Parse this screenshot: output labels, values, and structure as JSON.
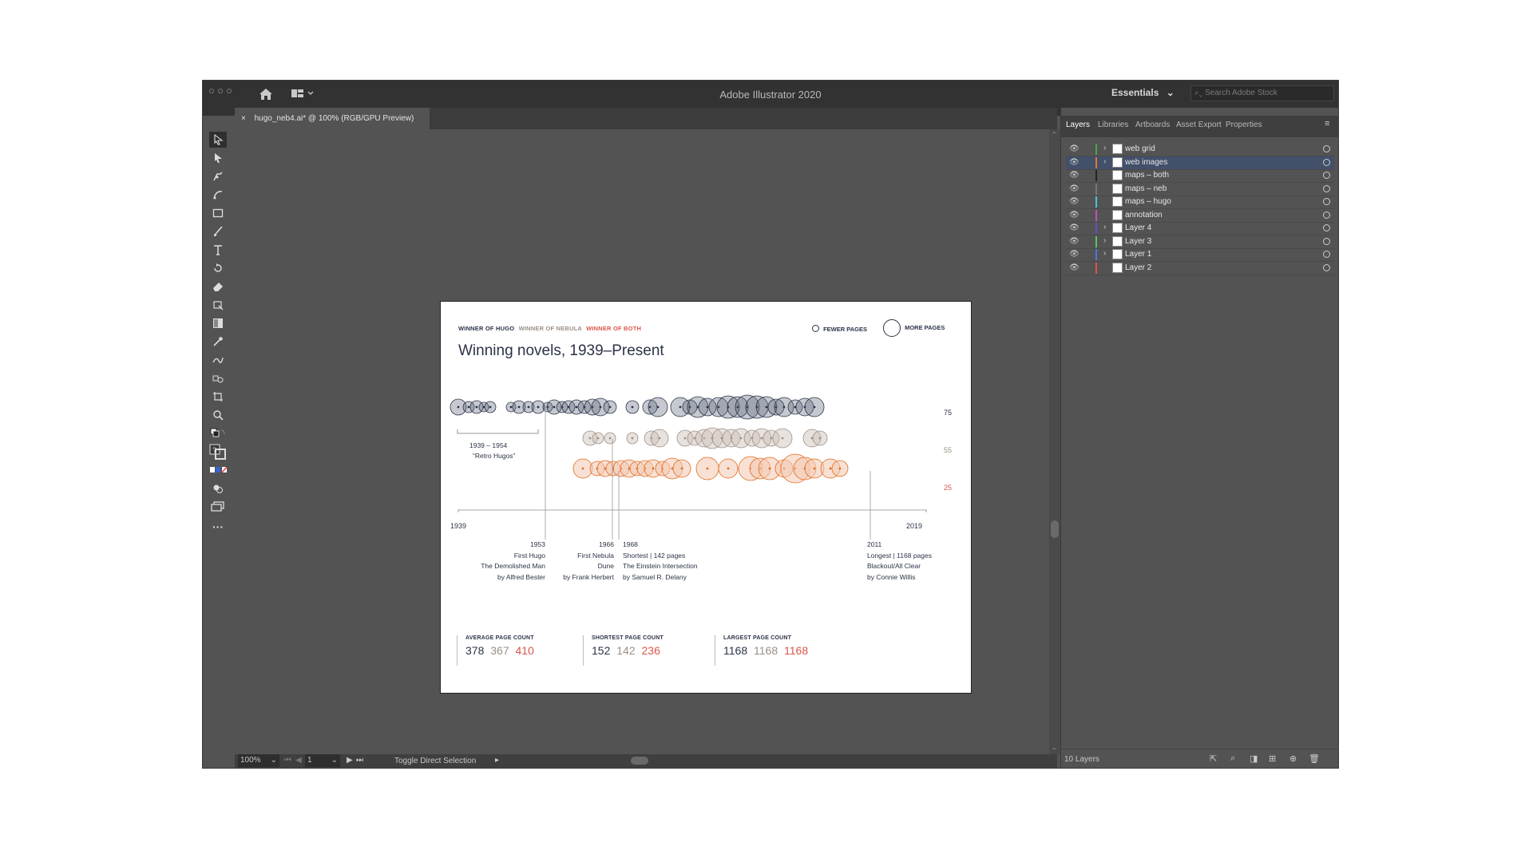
{
  "app": {
    "title": "Adobe Illustrator 2020",
    "workspace": "Essentials",
    "stock_search_placeholder": "Search Adobe Stock",
    "document_tab": "hugo_neb4.ai* @ 100% (RGB/GPU Preview)",
    "close_glyph": "×"
  },
  "status": {
    "zoom": "100%",
    "artboard": "1",
    "message": "Toggle Direct Selection"
  },
  "panel": {
    "tabs": [
      "Layers",
      "Libraries",
      "Artboards",
      "Asset Export",
      "Properties"
    ],
    "layers": [
      {
        "name": "web grid",
        "color": "#4aa34a",
        "expand": true,
        "selected": false
      },
      {
        "name": "web images",
        "color": "#e0782f",
        "expand": true,
        "selected": true
      },
      {
        "name": "maps – both",
        "color": "#222222",
        "expand": false,
        "selected": false
      },
      {
        "name": "maps – neb",
        "color": "#777777",
        "expand": false,
        "selected": false
      },
      {
        "name": "maps – hugo",
        "color": "#44c8d8",
        "expand": false,
        "selected": false
      },
      {
        "name": "annotation",
        "color": "#c050c0",
        "expand": false,
        "selected": false
      },
      {
        "name": "Layer 4",
        "color": "#6a4ad0",
        "expand": true,
        "selected": false
      },
      {
        "name": "Layer 3",
        "color": "#5ac85a",
        "expand": true,
        "selected": false
      },
      {
        "name": "Layer 1",
        "color": "#4a78e0",
        "expand": true,
        "selected": false
      },
      {
        "name": "Layer 2",
        "color": "#e05050",
        "expand": false,
        "selected": false
      }
    ],
    "footer": "10 Layers"
  },
  "artboard": {
    "legend": {
      "hugo": "WINNER OF HUGO",
      "nebula": "WINNER OF NEBULA",
      "both": "WINNER OF BOTH",
      "fewer": "FEWER PAGES",
      "more": "MORE PAGES"
    },
    "title": "Winning novels, 1939–Present",
    "row_labels": [
      "75",
      "55",
      "25"
    ],
    "axis": {
      "start": "1939",
      "end": "2019"
    },
    "retro": {
      "range": "1939 – 1954",
      "label": "“Retro Hugos”"
    },
    "annotations": [
      {
        "lines": [
          "1953",
          "First Hugo",
          "The Demolished Man",
          "by Alfred Bester"
        ]
      },
      {
        "lines": [
          "1966",
          "First Nebula",
          "Dune",
          "by Frank Herbert"
        ]
      },
      {
        "lines": [
          "1968",
          "Shortest  | 142 pages",
          "The Einstein Intersection",
          "by Samuel R. Delany"
        ]
      },
      {
        "lines": [
          "2011",
          "Longest | 1168 pages",
          "Blackout/All Clear",
          "by Connie Willis"
        ]
      }
    ],
    "stats": [
      {
        "label": "AVERAGE PAGE COUNT",
        "hugo": "378",
        "nebula": "367",
        "both": "410"
      },
      {
        "label": "SHORTEST PAGE COUNT",
        "hugo": "152",
        "nebula": "142",
        "both": "236"
      },
      {
        "label": "LARGEST PAGE COUNT",
        "hugo": "1168",
        "nebula": "1168",
        "both": "1168"
      }
    ],
    "colors": {
      "hugo": "#2b3347",
      "nebula": "#9c8f86",
      "both": "#e26a1f",
      "both_text": "#d9564a"
    }
  }
}
